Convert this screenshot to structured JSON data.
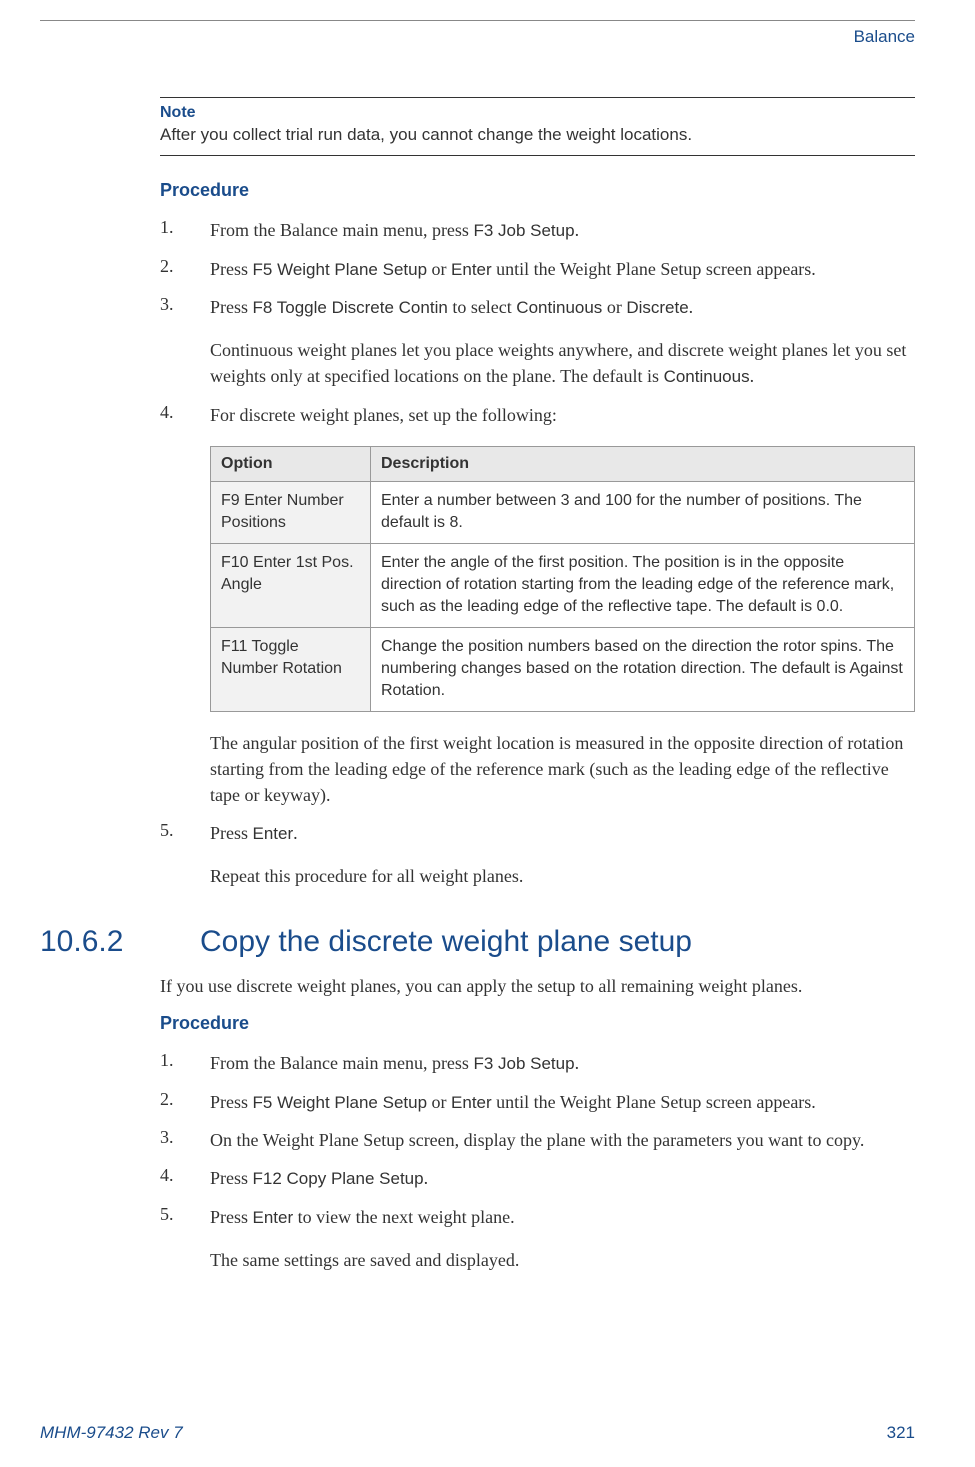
{
  "header": {
    "section": "Balance"
  },
  "note": {
    "label": "Note",
    "text": "After you collect trial run data, you cannot change the weight locations."
  },
  "procedure1": {
    "label": "Procedure",
    "steps": [
      {
        "num": "1.",
        "pre": "From the Balance main menu, press ",
        "ui": "F3 Job Setup",
        "post": "."
      },
      {
        "num": "2.",
        "pre": "Press ",
        "ui1": "F5 Weight Plane Setup",
        "mid": " or ",
        "ui2": "Enter",
        "post": " until the Weight Plane Setup screen appears."
      },
      {
        "num": "3.",
        "pre": "Press ",
        "ui1": "F8 Toggle Discrete Contin",
        "mid": " to select ",
        "ui2": "Continuous",
        "mid2": " or ",
        "ui3": "Discrete",
        "post": ".",
        "explain_pre": "Continuous weight planes let you place weights anywhere, and discrete weight planes let you set weights only at specified locations on the plane. The default is ",
        "explain_ui": "Continuous",
        "explain_post": "."
      },
      {
        "num": "4.",
        "text": "For discrete weight planes, set up the following:",
        "after_pre": "The angular position of the first weight location is measured in the opposite direction of rotation starting from the leading edge of the reference mark (such as the leading edge of the reflective tape or keyway)."
      },
      {
        "num": "5.",
        "pre": "Press ",
        "ui": "Enter",
        "post": ".",
        "after": "Repeat this procedure for all weight planes."
      }
    ],
    "table": {
      "head_option": "Option",
      "head_desc": "Description",
      "rows": [
        {
          "option": "F9 Enter Number Positions",
          "desc": "Enter a number between 3 and 100 for the number of positions. The default is 8."
        },
        {
          "option": "F10 Enter 1st Pos. Angle",
          "desc": "Enter the angle of the first position. The position is in the opposite direction of rotation starting from the leading edge of the reference mark, such as the leading edge of the reflective tape. The default is 0.0."
        },
        {
          "option": "F11 Toggle Number Rotation",
          "desc": "Change the position numbers based on the direction the rotor spins. The numbering changes based on the rotation direction. The default is Against Rotation."
        }
      ]
    }
  },
  "section2": {
    "number": "10.6.2",
    "title": "Copy the discrete weight plane setup",
    "intro": "If you use discrete weight planes, you can apply the setup to all remaining weight planes.",
    "procedure_label": "Procedure",
    "steps": [
      {
        "num": "1.",
        "pre": "From the Balance main menu, press ",
        "ui": "F3 Job Setup",
        "post": "."
      },
      {
        "num": "2.",
        "pre": "Press ",
        "ui1": "F5 Weight Plane Setup",
        "mid": " or ",
        "ui2": "Enter",
        "post": " until the Weight Plane Setup screen appears."
      },
      {
        "num": "3.",
        "text": "On the Weight Plane Setup screen, display the plane with the parameters you want to copy."
      },
      {
        "num": "4.",
        "pre": "Press ",
        "ui": "F12 Copy Plane Setup",
        "post": "."
      },
      {
        "num": "5.",
        "pre": "Press ",
        "ui": "Enter",
        "post": " to view the next weight plane.",
        "after": "The same settings are saved and displayed."
      }
    ]
  },
  "footer": {
    "doc": "MHM-97432 Rev 7",
    "page": "321"
  }
}
